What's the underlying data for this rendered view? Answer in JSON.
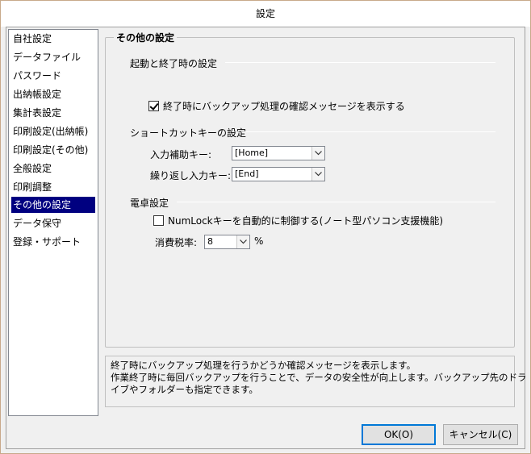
{
  "window": {
    "title": "設定"
  },
  "sidebar": {
    "items": [
      {
        "label": "自社設定",
        "selected": false
      },
      {
        "label": "データファイル",
        "selected": false
      },
      {
        "label": "パスワード",
        "selected": false
      },
      {
        "label": "出納帳設定",
        "selected": false
      },
      {
        "label": "集計表設定",
        "selected": false
      },
      {
        "label": "印刷設定(出納帳)",
        "selected": false
      },
      {
        "label": "印刷設定(その他)",
        "selected": false
      },
      {
        "label": "全般設定",
        "selected": false
      },
      {
        "label": "印刷調整",
        "selected": false
      },
      {
        "label": "その他の設定",
        "selected": true
      },
      {
        "label": "データ保守",
        "selected": false
      },
      {
        "label": "登録・サポート",
        "selected": false
      }
    ]
  },
  "main": {
    "group_title": "その他の設定",
    "startup": {
      "label": "起動と終了時の設定",
      "backup_confirm_label": "終了時にバックアップ処理の確認メッセージを表示する",
      "backup_confirm_checked": true
    },
    "shortcut": {
      "label": "ショートカットキーの設定",
      "input_assist_label": "入力補助キー:",
      "input_assist_value": "[Home]",
      "repeat_input_label": "繰り返し入力キー:",
      "repeat_input_value": "[End]"
    },
    "calculator": {
      "label": "電卓設定",
      "numlock_label": "NumLockキーを自動的に制御する(ノート型パソコン支援機能)",
      "numlock_checked": false,
      "tax_rate_label": "消費税率:",
      "tax_rate_value": "8",
      "tax_rate_unit": "%"
    }
  },
  "description": {
    "line1": "終了時にバックアップ処理を行うかどうか確認メッセージを表示します。",
    "line2": "作業終了時に毎回バックアップを行うことで、データの安全性が向上します。バックアップ先のドラ",
    "line3": "イブやフォルダーも指定できます。"
  },
  "buttons": {
    "ok_label": "OK(O)",
    "cancel_label": "キャンセル(C)"
  }
}
